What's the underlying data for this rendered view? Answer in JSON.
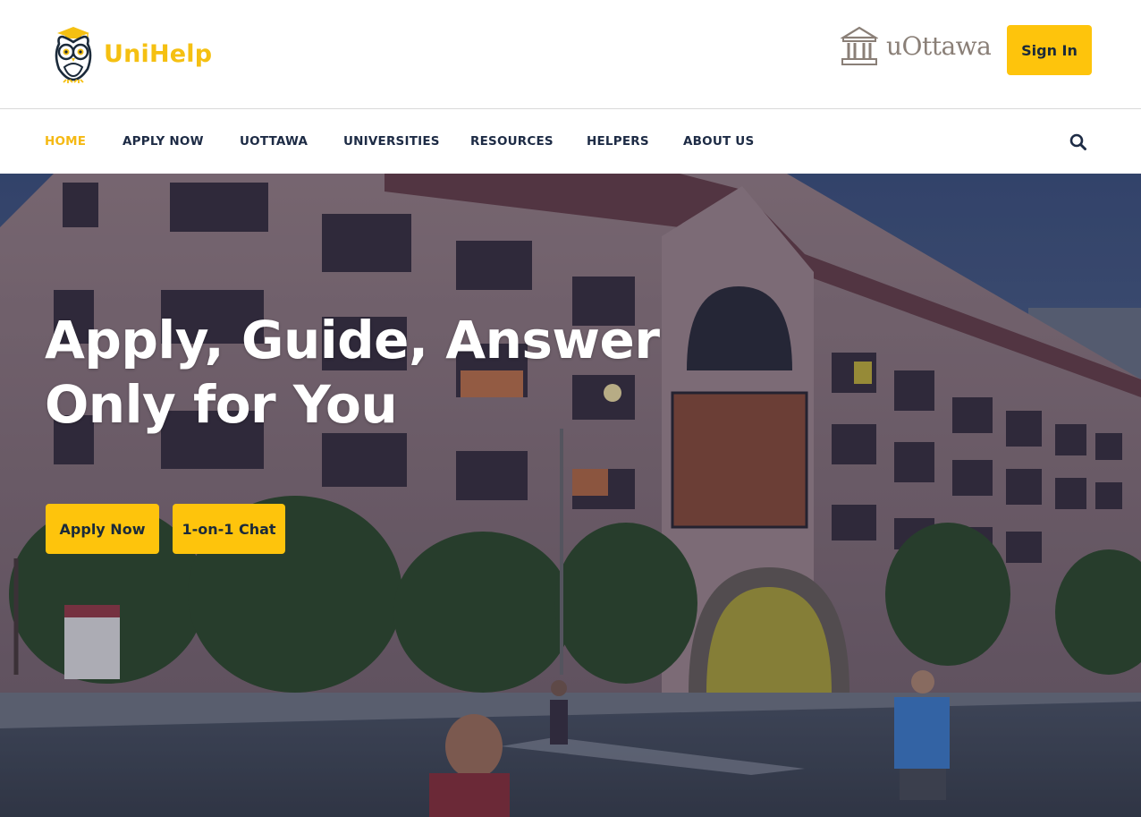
{
  "brand": {
    "name": "UniHelp",
    "accent_color": "#fec40c"
  },
  "partner": {
    "name": "uOttawa"
  },
  "header": {
    "signin_label": "Sign In"
  },
  "nav": {
    "items": [
      {
        "label": "HOME",
        "active": true
      },
      {
        "label": "APPLY NOW",
        "active": false
      },
      {
        "label": "UOTTAWA",
        "active": false
      },
      {
        "label": "UNIVERSITIES",
        "active": false
      },
      {
        "label": "RESOURCES",
        "active": false
      },
      {
        "label": "HELPERS",
        "active": false
      },
      {
        "label": "ABOUT US",
        "active": false
      }
    ],
    "search_icon": "search-icon"
  },
  "hero": {
    "headline_line1": "Apply, Guide, Answer",
    "headline_line2": "Only for You",
    "apply_button": "Apply Now",
    "chat_button": "1-on-1 Chat"
  }
}
